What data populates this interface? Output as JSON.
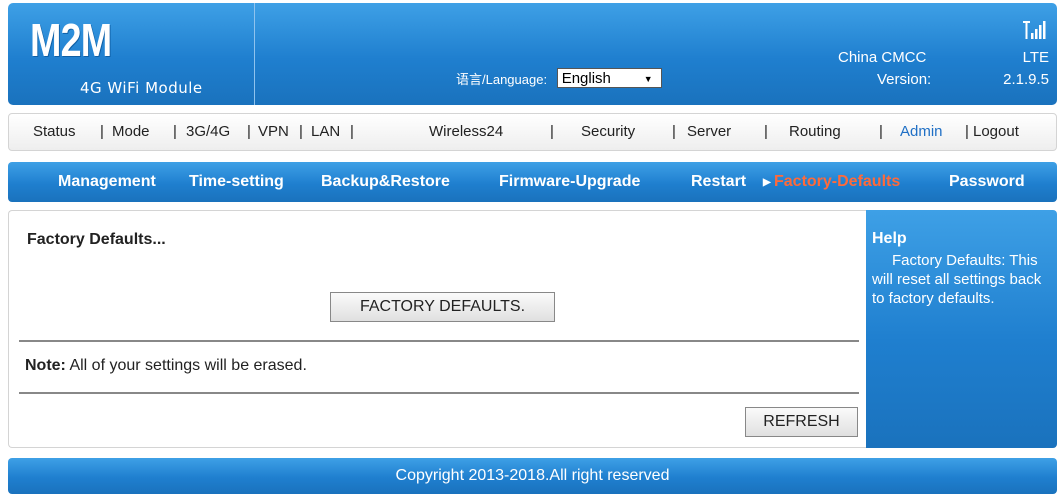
{
  "header": {
    "logo": "M2M",
    "logo_subtitle": "4G WiFi Module",
    "language_label": "语言/Language:",
    "language_selected": "English",
    "carrier": "China CMCC",
    "network_type": "LTE",
    "version_label": "Version:",
    "version_value": "2.1.9.5",
    "signal_icon": "signal-strength-icon"
  },
  "top_nav": {
    "items": [
      "Status",
      "Mode",
      "3G/4G",
      "VPN",
      "LAN",
      "Wireless24",
      "Security",
      "Server",
      "Routing",
      "Admin",
      "Logout"
    ],
    "active": "Admin"
  },
  "sub_nav": {
    "items": [
      "Management",
      "Time-setting",
      "Backup&Restore",
      "Firmware-Upgrade",
      "Restart",
      "Factory-Defaults",
      "Password"
    ],
    "active": "Factory-Defaults"
  },
  "main": {
    "title": "Factory Defaults...",
    "factory_button": "FACTORY DEFAULTS.",
    "note_label": "Note:",
    "note_text": "All of your settings will be erased.",
    "refresh_button": "REFRESH"
  },
  "help": {
    "title": "Help",
    "text": "Factory Defaults: This will reset all settings back to factory defaults."
  },
  "footer": {
    "copyright": "Copyright 2013-2018.All right reserved"
  },
  "colors": {
    "header_blue": "#1f7fcf",
    "active_nav": "#1f6fc5",
    "active_sub": "#ff6a3a"
  }
}
